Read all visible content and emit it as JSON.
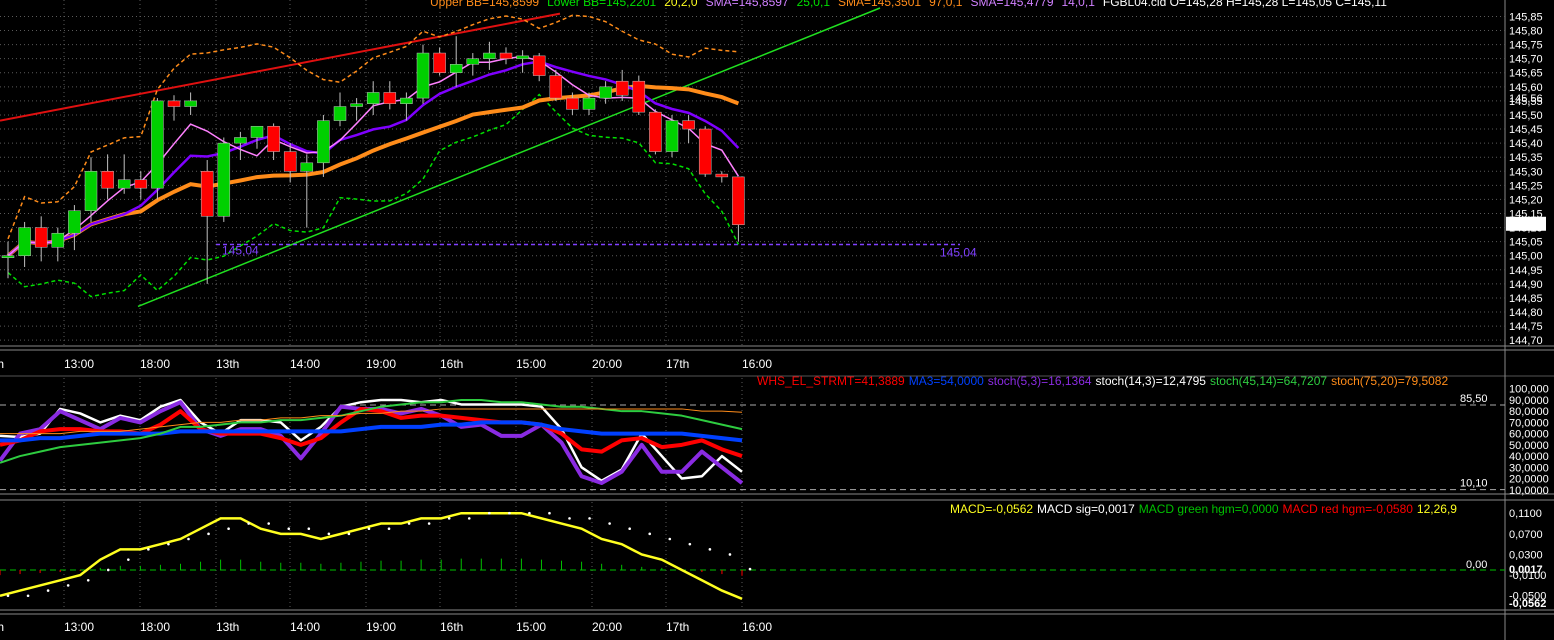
{
  "colors": {
    "background": "#000000",
    "grid": "#5a5a5a",
    "bull": "#00d000",
    "bear": "#ff0000",
    "sma_orange": "#ff8c1a",
    "sma_purple": "#7f00ff",
    "sma_pink": "#ff80ff",
    "bb_upper": "#ff8c1a",
    "bb_lower": "#00e000",
    "trend_red": "#e01010",
    "trend_green": "#20e020",
    "level": "#8040ff",
    "macd_line": "#ffff20",
    "macd_sig": "#ffffff",
    "stoch_white": "#ffffff",
    "stoch_purple": "#8a2be2",
    "stoch_red": "#ff0000",
    "stoch_blue": "#0040ff",
    "stoch_green": "#2ecc40",
    "zero_line": "#00c000"
  },
  "price_panel": {
    "legend": [
      {
        "text": "Upper BB=145,8599",
        "color": "#ff8c1a"
      },
      {
        "text": "Lower BB=145,2201",
        "color": "#00e000"
      },
      {
        "text": "20,2,0",
        "color": "#ffff20"
      },
      {
        "text": "SMA=145,8597",
        "color": "#d080ff"
      },
      {
        "text": "25,0,1",
        "color": "#00e000"
      },
      {
        "text": "SMA=145,3501",
        "color": "#ff8c1a"
      },
      {
        "text": "97,0,1",
        "color": "#ff8c1a"
      },
      {
        "text": "SMA=145,4779",
        "color": "#d080ff"
      },
      {
        "text": "14,0,1",
        "color": "#d080ff"
      },
      {
        "text": "FGBL04.cld O=145,28 H=145,28 L=145,05 C=145,11",
        "color": "#ffffff"
      }
    ],
    "level_label": "145,04",
    "last_price": "145,11",
    "sma_marker": "145,56",
    "upper_marker": "145,15"
  },
  "chart_data": [
    {
      "type": "candlestick",
      "title": "FGBL04.cld",
      "y_ticks": [
        "145,85",
        "145,80",
        "145,75",
        "145,70",
        "145,65",
        "145,60",
        "145,55",
        "145,50",
        "145,45",
        "145,40",
        "145,35",
        "145,30",
        "145,25",
        "145,20",
        "145,15",
        "145,10",
        "145,05",
        "145,00",
        "144,95",
        "144,90",
        "144,85",
        "144,80",
        "144,75",
        "144,70"
      ],
      "ylim": [
        144.69,
        145.88
      ],
      "time_labels": [
        "th",
        "13:00",
        "18:00",
        "13th",
        "14:00",
        "19:00",
        "16th",
        "15:00",
        "20:00",
        "17th",
        "16:00"
      ],
      "candles": [
        {
          "o": 145.0,
          "h": 145.05,
          "l": 144.92,
          "c": 145.0
        },
        {
          "o": 145.0,
          "h": 145.12,
          "l": 144.96,
          "c": 145.1
        },
        {
          "o": 145.1,
          "h": 145.14,
          "l": 144.98,
          "c": 145.03
        },
        {
          "o": 145.03,
          "h": 145.1,
          "l": 144.98,
          "c": 145.08
        },
        {
          "o": 145.08,
          "h": 145.18,
          "l": 145.02,
          "c": 145.16
        },
        {
          "o": 145.16,
          "h": 145.35,
          "l": 145.12,
          "c": 145.3
        },
        {
          "o": 145.3,
          "h": 145.36,
          "l": 145.2,
          "c": 145.24
        },
        {
          "o": 145.24,
          "h": 145.36,
          "l": 145.22,
          "c": 145.27
        },
        {
          "o": 145.27,
          "h": 145.3,
          "l": 145.2,
          "c": 145.24
        },
        {
          "o": 145.24,
          "h": 145.56,
          "l": 145.2,
          "c": 145.55
        },
        {
          "o": 145.55,
          "h": 145.57,
          "l": 145.48,
          "c": 145.53
        },
        {
          "o": 145.53,
          "h": 145.58,
          "l": 145.5,
          "c": 145.55
        },
        {
          "o": 145.3,
          "h": 145.34,
          "l": 144.9,
          "c": 145.14
        },
        {
          "o": 145.14,
          "h": 145.42,
          "l": 145.12,
          "c": 145.4
        },
        {
          "o": 145.4,
          "h": 145.44,
          "l": 145.34,
          "c": 145.42
        },
        {
          "o": 145.42,
          "h": 145.46,
          "l": 145.38,
          "c": 145.46
        },
        {
          "o": 145.46,
          "h": 145.47,
          "l": 145.34,
          "c": 145.37
        },
        {
          "o": 145.37,
          "h": 145.4,
          "l": 145.26,
          "c": 145.3
        },
        {
          "o": 145.3,
          "h": 145.36,
          "l": 145.1,
          "c": 145.33
        },
        {
          "o": 145.33,
          "h": 145.5,
          "l": 145.28,
          "c": 145.48
        },
        {
          "o": 145.48,
          "h": 145.58,
          "l": 145.46,
          "c": 145.53
        },
        {
          "o": 145.53,
          "h": 145.56,
          "l": 145.48,
          "c": 145.54
        },
        {
          "o": 145.54,
          "h": 145.62,
          "l": 145.5,
          "c": 145.58
        },
        {
          "o": 145.58,
          "h": 145.62,
          "l": 145.52,
          "c": 145.54
        },
        {
          "o": 145.54,
          "h": 145.58,
          "l": 145.48,
          "c": 145.56
        },
        {
          "o": 145.56,
          "h": 145.75,
          "l": 145.54,
          "c": 145.72
        },
        {
          "o": 145.72,
          "h": 145.74,
          "l": 145.64,
          "c": 145.65
        },
        {
          "o": 145.65,
          "h": 145.78,
          "l": 145.6,
          "c": 145.68
        },
        {
          "o": 145.68,
          "h": 145.72,
          "l": 145.64,
          "c": 145.7
        },
        {
          "o": 145.7,
          "h": 145.76,
          "l": 145.66,
          "c": 145.72
        },
        {
          "o": 145.72,
          "h": 145.74,
          "l": 145.68,
          "c": 145.7
        },
        {
          "o": 145.7,
          "h": 145.73,
          "l": 145.65,
          "c": 145.71
        },
        {
          "o": 145.71,
          "h": 145.72,
          "l": 145.62,
          "c": 145.64
        },
        {
          "o": 145.64,
          "h": 145.66,
          "l": 145.55,
          "c": 145.56
        },
        {
          "o": 145.56,
          "h": 145.58,
          "l": 145.5,
          "c": 145.52
        },
        {
          "o": 145.52,
          "h": 145.58,
          "l": 145.5,
          "c": 145.56
        },
        {
          "o": 145.56,
          "h": 145.62,
          "l": 145.54,
          "c": 145.6
        },
        {
          "o": 145.62,
          "h": 145.66,
          "l": 145.55,
          "c": 145.57
        },
        {
          "o": 145.62,
          "h": 145.64,
          "l": 145.5,
          "c": 145.51
        },
        {
          "o": 145.51,
          "h": 145.52,
          "l": 145.36,
          "c": 145.37
        },
        {
          "o": 145.37,
          "h": 145.5,
          "l": 145.35,
          "c": 145.48
        },
        {
          "o": 145.48,
          "h": 145.5,
          "l": 145.4,
          "c": 145.45
        },
        {
          "o": 145.45,
          "h": 145.46,
          "l": 145.28,
          "c": 145.29
        },
        {
          "o": 145.29,
          "h": 145.3,
          "l": 145.26,
          "c": 145.28
        },
        {
          "o": 145.28,
          "h": 145.28,
          "l": 145.05,
          "c": 145.11
        }
      ],
      "level": 145.04
    },
    {
      "type": "line",
      "title": "Stochastic",
      "legend": [
        {
          "text": "WHS_EL_STRMT=41,3889",
          "color": "#ff0000"
        },
        {
          "text": "MA3=54,0000",
          "color": "#0040ff"
        },
        {
          "text": "stoch(5,3)=16,1364",
          "color": "#8a2be2"
        },
        {
          "text": "stoch(14,3)=12,4795",
          "color": "#ffffff"
        },
        {
          "text": "stoch(45,14)=64,7207",
          "color": "#2ecc40"
        },
        {
          "text": "stoch(75,20)=79,5082",
          "color": "#ff8c1a"
        }
      ],
      "y_ticks": [
        "100,000",
        "90,0000",
        "80,0000",
        "70,0000",
        "60,0000",
        "50,0000",
        "40,0000",
        "30,0000",
        "20,0000",
        "10,0000"
      ],
      "ylim": [
        8,
        106
      ],
      "upper_band": "85,50",
      "lower_band": "10,10",
      "series": [
        {
          "color": "#ffffff",
          "values": [
            58,
            57,
            60,
            82,
            78,
            70,
            76,
            72,
            84,
            90,
            70,
            60,
            72,
            72,
            70,
            54,
            66,
            84,
            88,
            90,
            90,
            88,
            90,
            86,
            86,
            86,
            86,
            84,
            64,
            30,
            18,
            28,
            60,
            40,
            20,
            22,
            40,
            26
          ]
        },
        {
          "color": "#8a2be2",
          "values": [
            36,
            60,
            64,
            80,
            72,
            64,
            74,
            70,
            80,
            88,
            64,
            58,
            64,
            64,
            58,
            38,
            60,
            84,
            82,
            82,
            78,
            82,
            76,
            66,
            68,
            58,
            58,
            68,
            52,
            22,
            16,
            26,
            50,
            26,
            26,
            44,
            30,
            16
          ]
        },
        {
          "color": "#ff0000",
          "values": [
            50,
            54,
            62,
            64,
            64,
            62,
            62,
            60,
            68,
            80,
            64,
            60,
            60,
            60,
            56,
            50,
            56,
            70,
            82,
            80,
            74,
            76,
            76,
            74,
            72,
            70,
            70,
            68,
            60,
            46,
            44,
            54,
            56,
            48,
            50,
            54,
            46,
            40
          ]
        },
        {
          "color": "#0040ff",
          "values": [
            54,
            54,
            56,
            56,
            58,
            60,
            60,
            60,
            60,
            62,
            62,
            62,
            62,
            62,
            62,
            62,
            62,
            62,
            64,
            66,
            66,
            66,
            68,
            68,
            70,
            70,
            70,
            68,
            64,
            62,
            60,
            60,
            60,
            60,
            60,
            58,
            56,
            54
          ]
        },
        {
          "color": "#2ecc40",
          "values": [
            34,
            40,
            44,
            48,
            50,
            52,
            54,
            56,
            60,
            66,
            66,
            68,
            70,
            70,
            72,
            72,
            74,
            76,
            80,
            84,
            86,
            88,
            88,
            90,
            90,
            88,
            88,
            86,
            84,
            84,
            82,
            80,
            80,
            78,
            76,
            72,
            68,
            64
          ]
        },
        {
          "color": "#ff8c1a",
          "values": [
            60,
            60,
            60,
            60,
            62,
            62,
            62,
            64,
            66,
            68,
            70,
            70,
            72,
            72,
            74,
            74,
            76,
            76,
            78,
            78,
            80,
            80,
            82,
            82,
            82,
            82,
            82,
            82,
            82,
            82,
            82,
            82,
            82,
            82,
            82,
            80,
            80,
            79
          ]
        }
      ]
    },
    {
      "type": "line",
      "title": "MACD",
      "legend": [
        {
          "text": "MACD=-0,0562",
          "color": "#ffff20"
        },
        {
          "text": "MACD sig=0,0017",
          "color": "#ffffff"
        },
        {
          "text": "MACD green hgm=0,0000",
          "color": "#00c000"
        },
        {
          "text": "MACD red hgm=-0,0580",
          "color": "#ff0000"
        },
        {
          "text": "12,26,9",
          "color": "#ffff20"
        }
      ],
      "y_ticks": [
        "0,1100",
        "0,0700",
        "0,0300",
        "-0,0100",
        "-0,0500"
      ],
      "ylim": [
        -0.066,
        0.124
      ],
      "zero_label": "0,00",
      "sig_marker": "0,0017",
      "macd_marker": "-0,0562",
      "macd": [
        -0.05,
        -0.04,
        -0.03,
        -0.02,
        -0.01,
        0.02,
        0.04,
        0.04,
        0.05,
        0.06,
        0.08,
        0.1,
        0.1,
        0.08,
        0.07,
        0.07,
        0.06,
        0.07,
        0.08,
        0.09,
        0.09,
        0.1,
        0.1,
        0.11,
        0.11,
        0.11,
        0.11,
        0.1,
        0.09,
        0.08,
        0.06,
        0.05,
        0.03,
        0.02,
        0.0,
        -0.02,
        -0.04,
        -0.056
      ],
      "signal": [
        -0.05,
        -0.05,
        -0.04,
        -0.03,
        -0.02,
        0.0,
        0.02,
        0.04,
        0.05,
        0.06,
        0.07,
        0.08,
        0.09,
        0.09,
        0.08,
        0.08,
        0.07,
        0.07,
        0.08,
        0.08,
        0.09,
        0.09,
        0.1,
        0.1,
        0.11,
        0.11,
        0.11,
        0.11,
        0.1,
        0.1,
        0.09,
        0.08,
        0.07,
        0.06,
        0.05,
        0.04,
        0.03,
        0.0017
      ]
    }
  ]
}
